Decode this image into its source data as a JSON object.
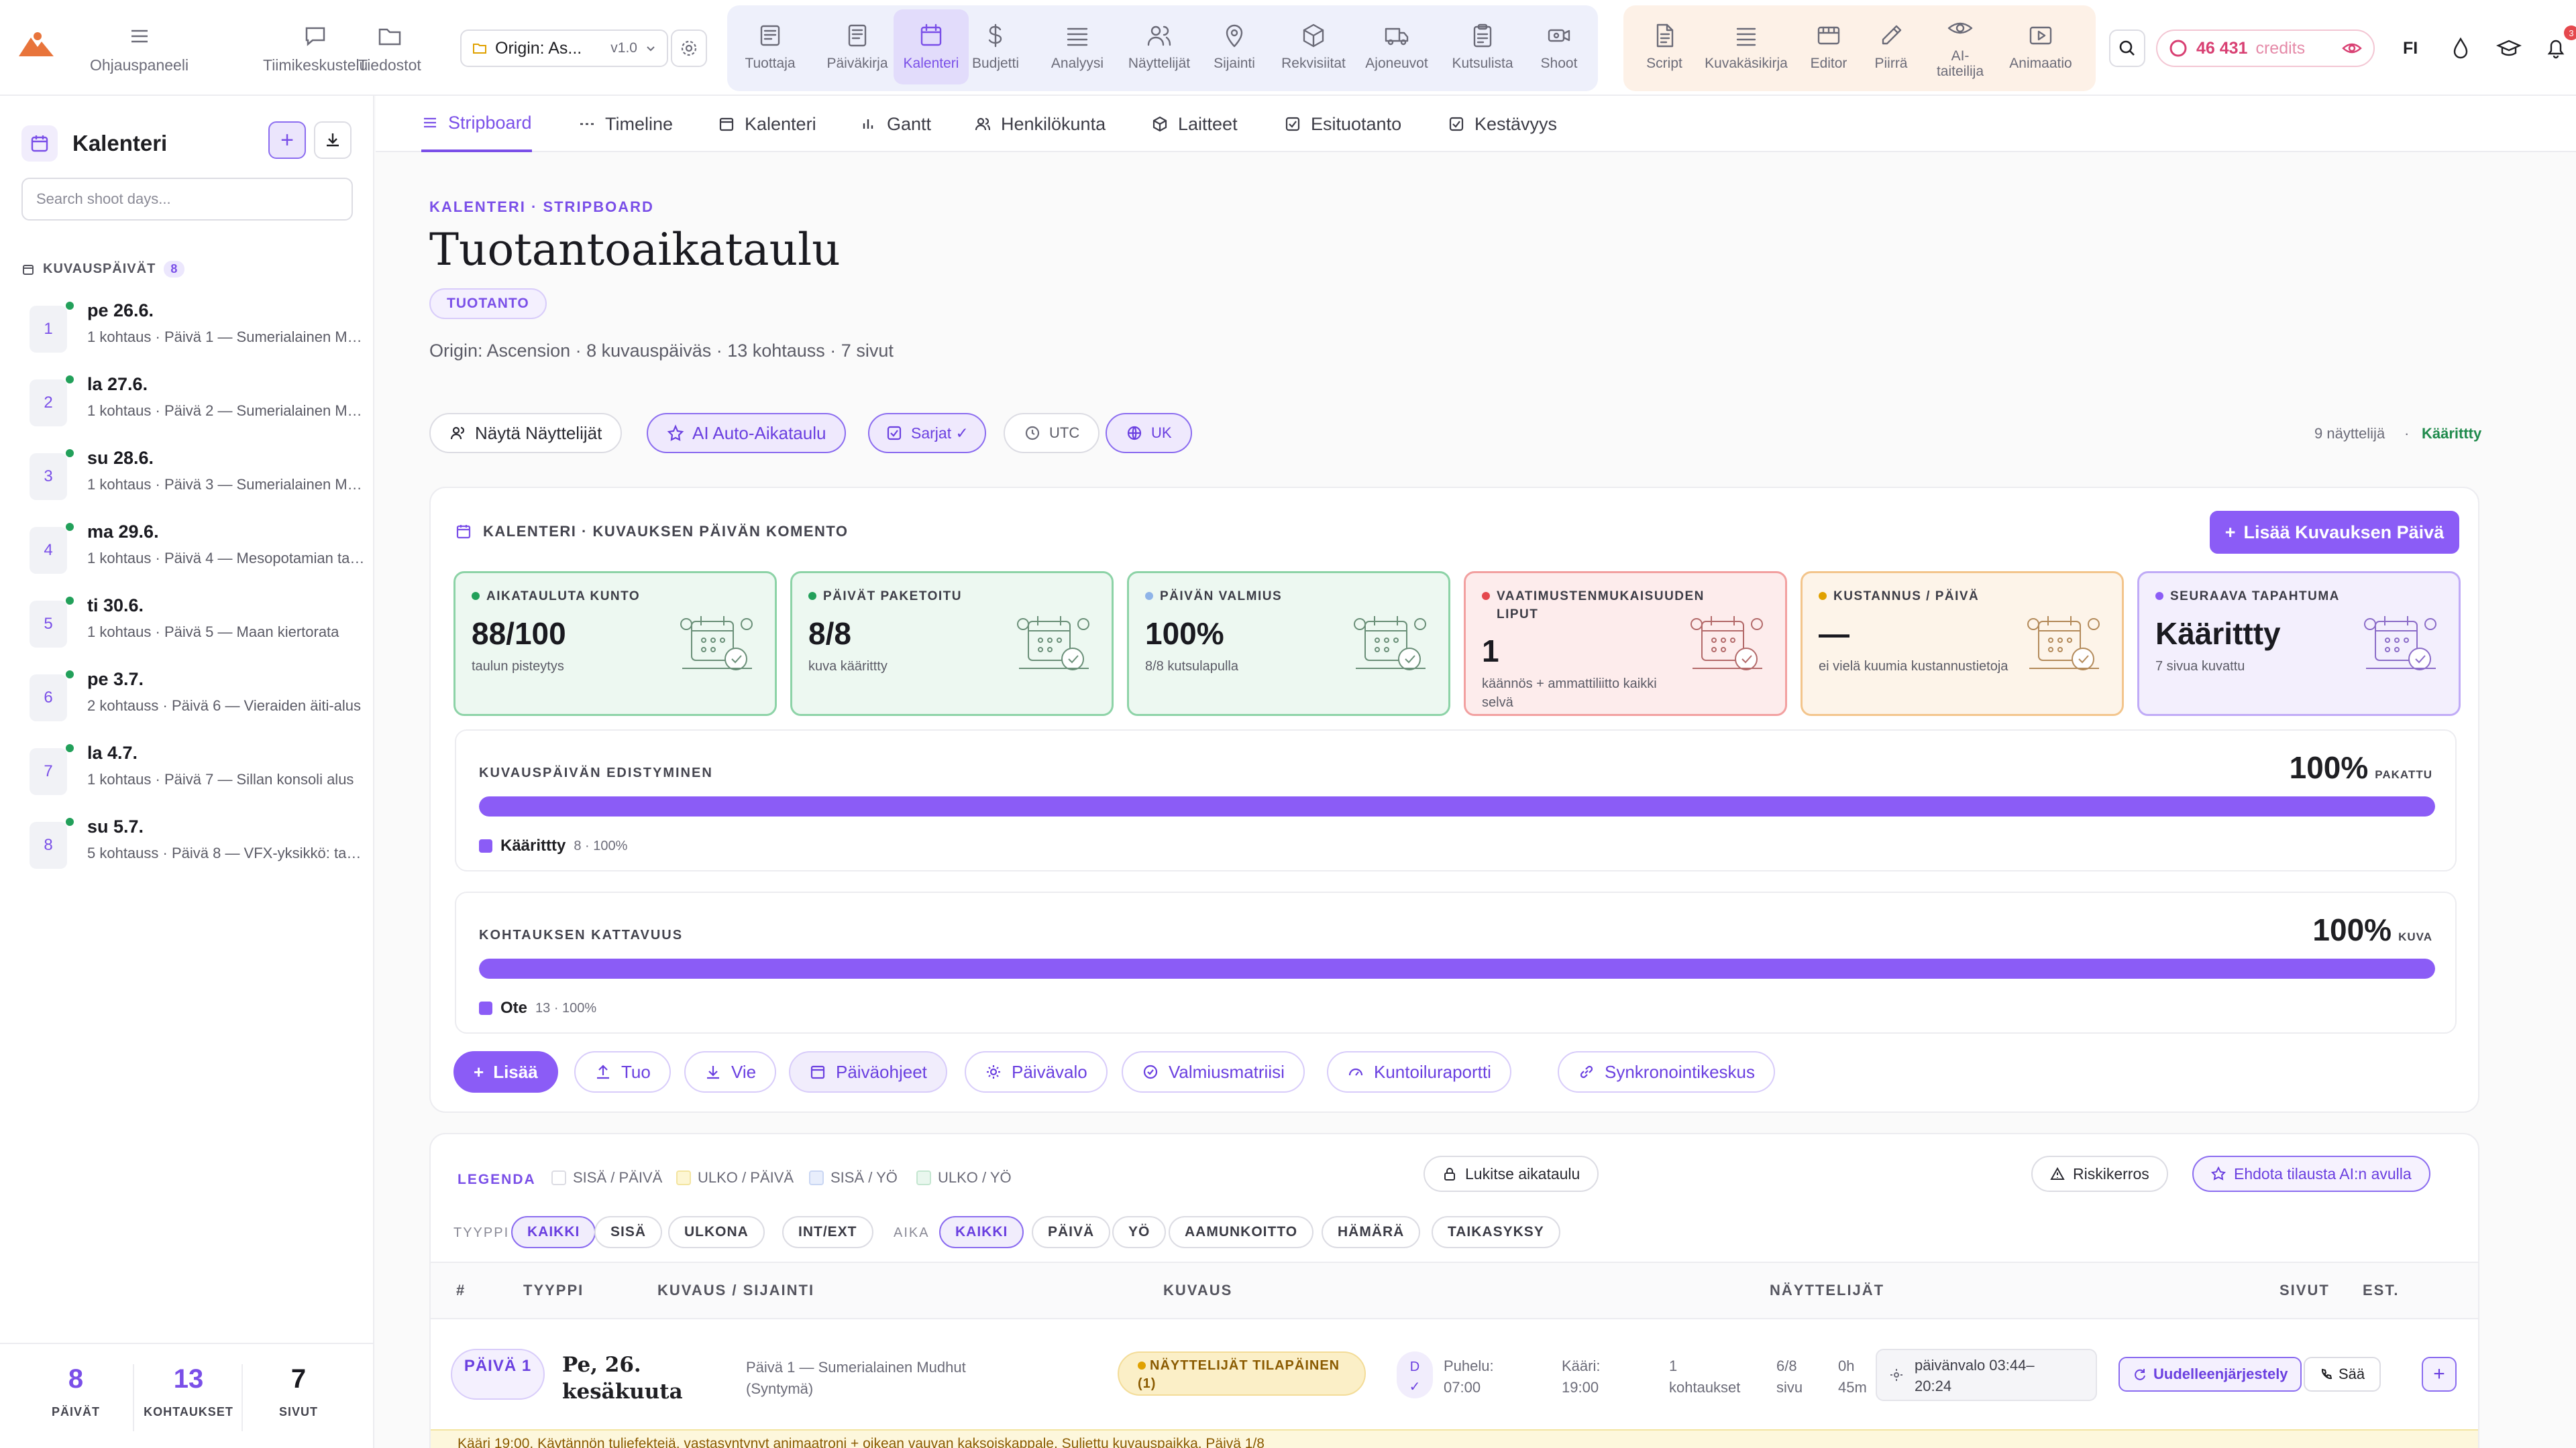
{
  "topbar": {
    "nav": [
      {
        "label": "Ohjauspaneeli",
        "icon": "menu-icon"
      },
      {
        "label": "Tiimikeskustelu",
        "icon": "chat-icon"
      },
      {
        "label": "Tiedostot",
        "icon": "folder-icon"
      }
    ],
    "project": {
      "name": "Origin: As...",
      "version": "v1.0"
    },
    "tools": [
      {
        "label": "Tuottaja",
        "icon": "dashboard-icon"
      },
      {
        "label": "Päiväkirja",
        "icon": "journal-icon"
      },
      {
        "label": "Kalenteri",
        "icon": "calendar-icon",
        "active": true
      },
      {
        "label": "Budjetti",
        "icon": "dollar-icon"
      },
      {
        "label": "Analyysi",
        "icon": "layers-icon"
      },
      {
        "label": "Näyttelijät",
        "icon": "people-icon"
      },
      {
        "label": "Sijainti",
        "icon": "pin-icon"
      },
      {
        "label": "Rekvisiitat",
        "icon": "box-icon"
      },
      {
        "label": "Ajoneuvot",
        "icon": "truck-icon"
      },
      {
        "label": "Kutsulista",
        "icon": "clipboard-icon"
      },
      {
        "label": "Shoot",
        "icon": "camera-icon"
      }
    ],
    "creative": [
      {
        "label": "Script",
        "icon": "script-icon"
      },
      {
        "label": "Kuvakäsikirja",
        "icon": "list-icon"
      },
      {
        "label": "Editor",
        "icon": "editor-icon"
      },
      {
        "label": "Piirrä",
        "icon": "pencil-icon"
      },
      {
        "label": "AI-\ntaiteilija",
        "icon": "eye-icon"
      },
      {
        "label": "Animaatio",
        "icon": "play-icon"
      }
    ],
    "credits": {
      "value": "46 431",
      "unit": "credits"
    },
    "language": "FI",
    "notification_count": "3"
  },
  "sidebar": {
    "title": "Kalenteri",
    "search_placeholder": "Search shoot days...",
    "section_label": "KUVAUSPÄIVÄT",
    "section_count": "8",
    "days": [
      {
        "num": "1",
        "date": "pe 26.6.",
        "sub": "1 kohtaus · Päivä 1 — Sumerialainen Mudhut"
      },
      {
        "num": "2",
        "date": "la 27.6.",
        "sub": "1 kohtaus · Päivä 2 — Sumerialainen Mudhut"
      },
      {
        "num": "3",
        "date": "su 28.6.",
        "sub": "1 kohtaus · Päivä 3 — Sumerialainen Mudhut"
      },
      {
        "num": "4",
        "date": "ma 29.6.",
        "sub": "1 kohtaus · Päivä 4 — Mesopotamian tasanko"
      },
      {
        "num": "5",
        "date": "ti 30.6.",
        "sub": "1 kohtaus · Päivä 5 — Maan kiertorata"
      },
      {
        "num": "6",
        "date": "pe 3.7.",
        "sub": "2 kohtauss · Päivä 6 — Vieraiden äiti-alus"
      },
      {
        "num": "7",
        "date": "la 4.7.",
        "sub": "1 kohtaus · Päivä 7 — Sillan konsoli alus"
      },
      {
        "num": "8",
        "date": "su 5.7.",
        "sub": "5 kohtauss · Päivä 8 — VFX-yksikkö: taustat"
      }
    ],
    "stats": [
      {
        "value": "8",
        "label": "PÄIVÄT"
      },
      {
        "value": "13",
        "label": "KOHTAUKSET"
      },
      {
        "value": "7",
        "label": "SIVUT"
      }
    ]
  },
  "subtabs": [
    {
      "label": "Stripboard",
      "active": true
    },
    {
      "label": "Timeline"
    },
    {
      "label": "Kalenteri"
    },
    {
      "label": "Gantt"
    },
    {
      "label": "Henkilökunta"
    },
    {
      "label": "Laitteet"
    },
    {
      "label": "Esituotanto"
    },
    {
      "label": "Kestävyys"
    }
  ],
  "page": {
    "breadcrumb": "KALENTERI · STRIPBOARD",
    "title": "Tuotantoaikataulu",
    "badge": "TUOTANTO",
    "meta": "Origin: Ascension · 8 kuvauspäiväs · 13 kohtauss · 7 sivut"
  },
  "chips": {
    "show_actors": "Näytä Näyttelijät",
    "ai_schedule": "AI Auto-Aikataulu",
    "series": "Sarjat ✓",
    "utc": "UTC",
    "uk": "UK",
    "actor_count": "9 näyttelijä",
    "sep": "·",
    "status": "Käärittty"
  },
  "panel": {
    "header": "KALENTERI · KUVAUKSEN PÄIVÄN KOMENTO",
    "add_day": "Lisää Kuvauksen Päivä",
    "cards": [
      {
        "title": "AIKATAULUTA KUNTO",
        "value": "88/100",
        "sub": "taulun pisteytys",
        "dot": "#22a05a"
      },
      {
        "title": "PÄIVÄT PAKETOITU",
        "value": "8/8",
        "sub": "kuva käärittty",
        "dot": "#22a05a"
      },
      {
        "title": "PÄIVÄN VALMIUS",
        "value": "100%",
        "sub": "8/8 kutsulapulla",
        "dot": "#8fb4e8"
      },
      {
        "title": "VAATIMUSTENMUKAISUUDEN LIPUT",
        "value": "1",
        "sub": "käännös + ammattiliitto kaikki selvä",
        "dot": "#e5484d"
      },
      {
        "title": "KUSTANNUS / PÄIVÄ",
        "value": "—",
        "sub": "ei vielä kuumia kustannustietoja",
        "dot": "#e0a100"
      },
      {
        "title": "SEURAAVA TAPAHTUMA",
        "value": "Käärittty",
        "sub": "7 sivua kuvattu",
        "dot": "#8b5cf6"
      }
    ],
    "progress": [
      {
        "title": "KUVAUSPÄIVÄN EDISTYMINEN",
        "pct": "100%",
        "unit": "PAKATTU",
        "fill": 1.0,
        "legend": "Käärittty",
        "legend_count": "8 · 100%"
      },
      {
        "title": "KOHTAUKSEN KATTAVUUS",
        "pct": "100%",
        "unit": "KUVA",
        "fill": 1.0,
        "legend": "Ote",
        "legend_count": "13 · 100%"
      }
    ],
    "actions": [
      "Lisää",
      "Tuo",
      "Vie",
      "Päiväohjeet",
      "Päivävalo",
      "Valmiusmatriisi",
      "Kuntoiluraportti",
      "Synkronointikeskus"
    ]
  },
  "table": {
    "legend_label": "LEGENDA",
    "legend": [
      "SISÄ / PÄIVÄ",
      "ULKO / PÄIVÄ",
      "SISÄ / YÖ",
      "ULKO / YÖ"
    ],
    "lock": "Lukitse aikataulu",
    "risk": "Riskikerros",
    "ai_suggest": "Ehdota tilausta AI:n avulla",
    "type_label": "TYYPPI",
    "type_filters": [
      "KAIKKI",
      "SISÄ",
      "ULKONA",
      "INT/EXT"
    ],
    "time_label": "AIKA",
    "time_filters": [
      "KAIKKI",
      "PÄIVÄ",
      "YÖ",
      "AAMUNKOITTO",
      "HÄMÄRÄ",
      "TAIKASYKSY"
    ],
    "headers": [
      "#",
      "TYYPPI",
      "KUVAUS / SIJAINTI",
      "KUVAUS",
      "NÄYTTELIJÄT",
      "SIVUT",
      "EST."
    ],
    "row": {
      "badge": "PÄIVÄ 1",
      "date": "Pe, 26. kesäkuuta",
      "loc1": "Päivä 1 — Sumerialainen Mudhut",
      "loc2": "(Syntymä)",
      "warn": "NÄYTTELIJÄT TILAPÄINEN (1)",
      "d": "D",
      "d2": "✓",
      "call_label": "Puhelu:",
      "call_time": "07:00",
      "wrap_label": "Kääri:",
      "wrap_time": "19:00",
      "scenes1": "1",
      "scenes2": "kohtaukset",
      "pages1": "6/8",
      "pages2": "sivu",
      "est1": "0h",
      "est2": "45m",
      "daylight1": "päivänvalo 03:44–",
      "daylight2": "20:24",
      "reschedule": "Uudelleenjärjestely",
      "weather": "Sää",
      "plus": "+"
    },
    "note": "Kääri 19:00. Käytännön tuliefektejä, vastasyntynyt animaatroni + oikean vauvan kaksoiskappale. Suljettu kuvauspaikka. Päivä 1/8"
  }
}
